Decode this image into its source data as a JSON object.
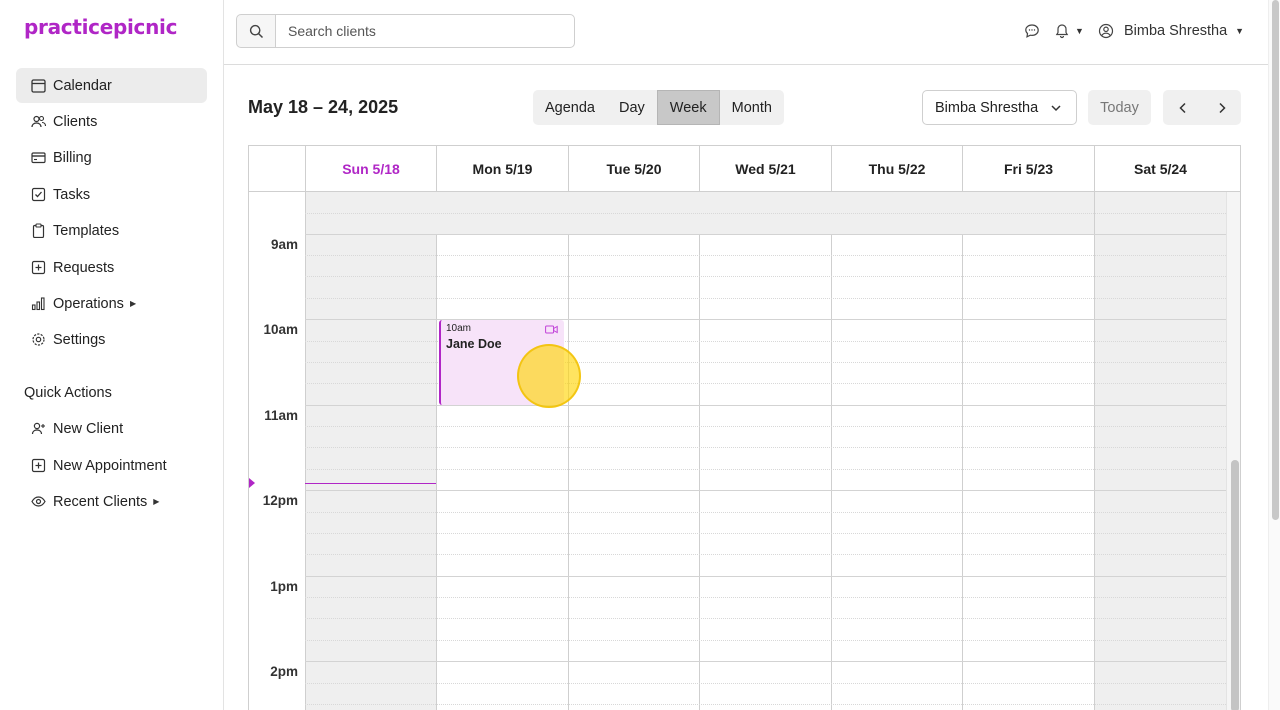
{
  "app": {
    "brand": "practicepicnic"
  },
  "sidebar": {
    "items": [
      {
        "label": "Calendar",
        "icon": "calendar-icon",
        "active": true
      },
      {
        "label": "Clients",
        "icon": "users-icon"
      },
      {
        "label": "Billing",
        "icon": "credit-card-icon"
      },
      {
        "label": "Tasks",
        "icon": "checkbox-icon"
      },
      {
        "label": "Templates",
        "icon": "clipboard-icon"
      },
      {
        "label": "Requests",
        "icon": "plus-square-icon"
      },
      {
        "label": "Operations",
        "icon": "bar-chart-icon",
        "expandable": true
      },
      {
        "label": "Settings",
        "icon": "gear-icon"
      }
    ],
    "quick_actions_title": "Quick Actions",
    "quick_actions": [
      {
        "label": "New Client",
        "icon": "user-plus-icon"
      },
      {
        "label": "New Appointment",
        "icon": "plus-square-icon"
      },
      {
        "label": "Recent Clients",
        "icon": "eye-icon",
        "expandable": true
      }
    ]
  },
  "topbar": {
    "search_placeholder": "Search clients",
    "user_name": "Bimba Shrestha"
  },
  "calendar": {
    "range_title": "May 18 – 24, 2025",
    "views": [
      "Agenda",
      "Day",
      "Week",
      "Month"
    ],
    "active_view": "Week",
    "owner": "Bimba Shrestha",
    "today_label": "Today",
    "days": [
      "Sun 5/18",
      "Mon 5/19",
      "Tue 5/20",
      "Wed 5/21",
      "Thu 5/22",
      "Fri 5/23",
      "Sat 5/24"
    ],
    "today_index": 0,
    "hours": [
      "9am",
      "10am",
      "11am",
      "12pm",
      "1pm",
      "2pm"
    ],
    "event": {
      "time": "10am",
      "client": "Jane Doe",
      "type": "video"
    }
  },
  "colors": {
    "brand": "#b026c6",
    "event_bg": "#f7e3f9",
    "weekend_shade": "#efefef"
  }
}
